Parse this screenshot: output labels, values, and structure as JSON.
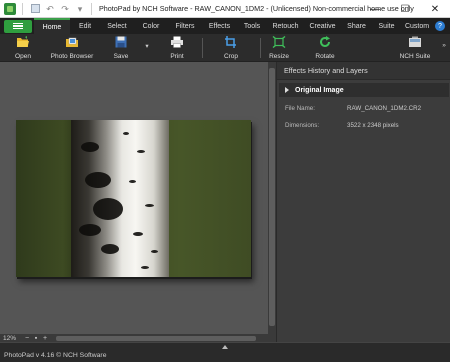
{
  "window": {
    "title": "PhotoPad by NCH Software - RAW_CANON_1DM2 - (Unlicensed) Non-commercial home use only",
    "minimize": "—",
    "maximize": "☐",
    "close": "✕"
  },
  "menu": {
    "tabs": [
      "Home",
      "Edit",
      "Select",
      "Color",
      "Filters",
      "Effects",
      "Tools",
      "Retouch",
      "Creative",
      "Share",
      "Suite",
      "Custom"
    ],
    "active": "Home",
    "help": "?"
  },
  "toolbar": {
    "open": "Open",
    "photo_browser": "Photo Browser",
    "save": "Save",
    "print": "Print",
    "crop": "Crop",
    "resize": "Resize",
    "rotate": "Rotate",
    "nch_suite": "NCH Suite",
    "more": "»"
  },
  "panel": {
    "title": "Effects History and Layers",
    "section": "Original Image",
    "file_name_label": "File Name:",
    "file_name_value": "RAW_CANON_1DM2.CR2",
    "dimensions_label": "Dimensions:",
    "dimensions_value": "3522 x 2348 pixels"
  },
  "zoom": {
    "value": "12%",
    "minus": "−",
    "plus": "+",
    "fit": "▪"
  },
  "status": {
    "text": "PhotoPad v 4.16 © NCH Software"
  },
  "colors": {
    "accent": "#2f9e3f",
    "toolbar_bg": "#2c2c2c",
    "canvas_bg": "#555555"
  },
  "icons": [
    "app-icon",
    "save-icon",
    "undo-icon",
    "redo-icon",
    "menu-icon",
    "open-icon",
    "photo-browser-icon",
    "print-icon",
    "crop-icon",
    "resize-icon",
    "rotate-icon",
    "nch-suite-icon",
    "help-icon"
  ]
}
